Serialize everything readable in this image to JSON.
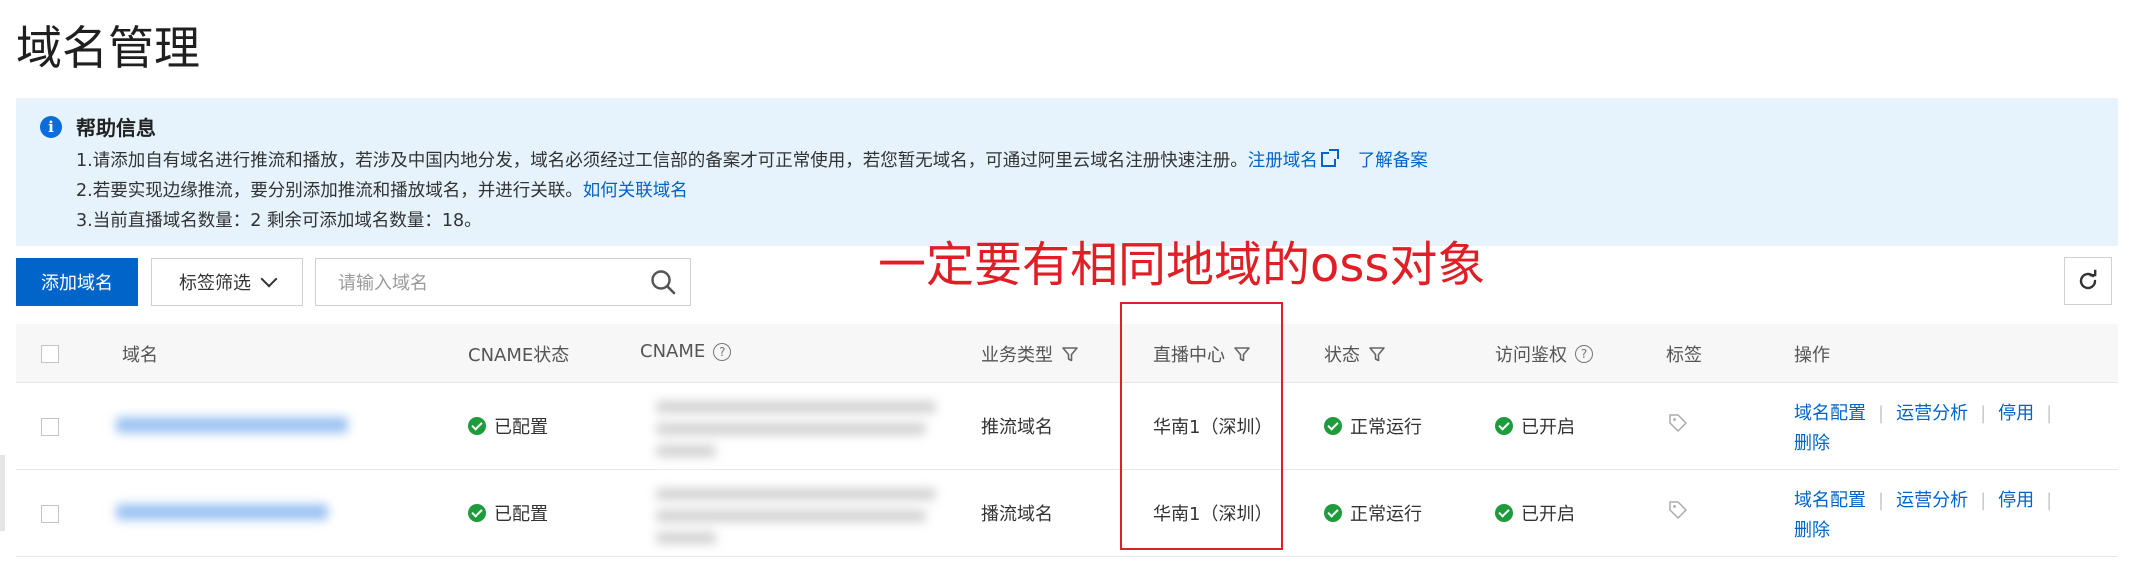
{
  "page": {
    "title": "域名管理"
  },
  "help": {
    "title": "帮助信息",
    "line1_text": "1.请添加自有域名进行推流和播放，若涉及中国内地分发，域名必须经过工信部的备案才可正常使用，若您暂无域名，可通过阿里云域名注册快速注册。",
    "line1_link1": "注册域名",
    "line1_link2": "了解备案",
    "line2_text": "2.若要实现边缘推流，要分别添加推流和播放域名，并进行关联。",
    "line2_link": "如何关联域名",
    "line3_text": "3.当前直播域名数量：2 剩余可添加域名数量：18。"
  },
  "toolbar": {
    "add_domain_label": "添加域名",
    "tag_filter_label": "标签筛选",
    "search_placeholder": "请输入域名"
  },
  "annotation": {
    "text": "一定要有相同地域的oss对象"
  },
  "table": {
    "columns": {
      "domain": "域名",
      "cname_status": "CNAME状态",
      "cname": "CNAME",
      "business_type": "业务类型",
      "live_center": "直播中心",
      "status": "状态",
      "auth": "访问鉴权",
      "tags": "标签",
      "actions": "操作"
    },
    "rows": [
      {
        "cname_status": "已配置",
        "business_type": "推流域名",
        "live_center": "华南1（深圳）",
        "status": "正常运行",
        "auth": "已开启",
        "actions": [
          "域名配置",
          "运营分析",
          "停用",
          "删除"
        ]
      },
      {
        "cname_status": "已配置",
        "business_type": "播流域名",
        "live_center": "华南1（深圳）",
        "status": "正常运行",
        "auth": "已开启",
        "actions": [
          "域名配置",
          "运营分析",
          "停用",
          "删除"
        ]
      }
    ]
  },
  "colors": {
    "primary": "#0064c8",
    "help_bg": "#e6f3fd",
    "success": "#1e9b3b",
    "annotation_red": "#e01e26"
  }
}
